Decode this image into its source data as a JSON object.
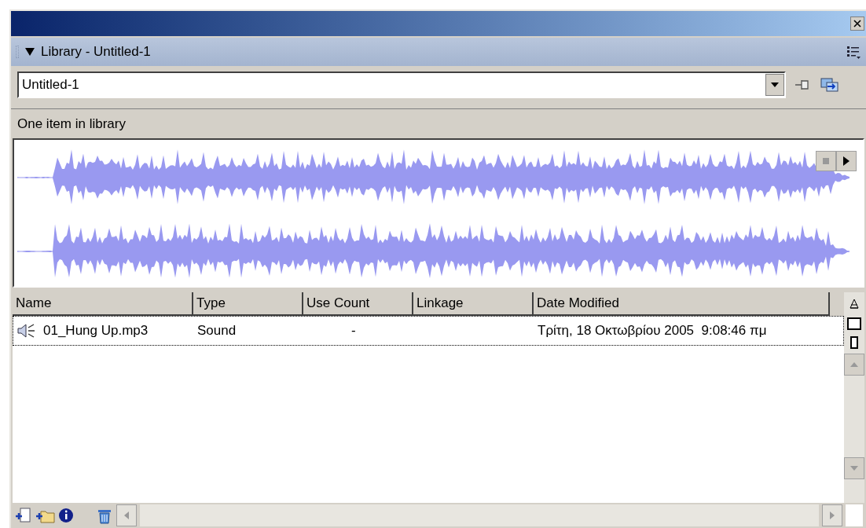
{
  "panel": {
    "title": "Library - Untitled-1"
  },
  "document_select": {
    "value": "Untitled-1"
  },
  "status": "One item in library",
  "table": {
    "columns": [
      "Name",
      "Type",
      "Use Count",
      "Linkage",
      "Date Modified"
    ],
    "rows": [
      {
        "kind": "sound",
        "selected": true,
        "cells": [
          "01_Hung Up.mp3",
          "Sound",
          "-",
          "",
          "Τρίτη, 18 Οκτωβρίου 2005  9:08:46 πμ"
        ]
      }
    ]
  }
}
